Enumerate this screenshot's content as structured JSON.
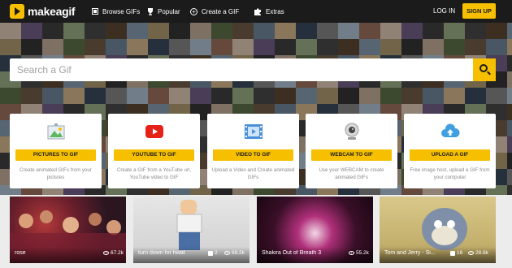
{
  "brand": {
    "name": "makeagif",
    "accent": "#f6c000",
    "nav_bg": "#1b1b1b"
  },
  "nav": {
    "items": [
      {
        "label": "Browse GIFs",
        "icon": "grid-icon"
      },
      {
        "label": "Popular",
        "icon": "trophy-icon"
      },
      {
        "label": "Create a GIF",
        "icon": "plus-circle-icon"
      },
      {
        "label": "Extras",
        "icon": "puzzle-icon"
      }
    ],
    "login": "LOG IN",
    "signup": "SIGN UP"
  },
  "search": {
    "placeholder": "Search a Gif",
    "value": "",
    "icon": "search-icon"
  },
  "cards": [
    {
      "button": "PICTURES TO GIF",
      "desc": "Create animated GIFs from your pictures",
      "icon": "picture-icon"
    },
    {
      "button": "YOUTUBE TO GIF",
      "desc": "Create a GIF from a YouTube url, YouTube video to GIF",
      "icon": "youtube-icon"
    },
    {
      "button": "VIDEO TO GIF",
      "desc": "Upload a Video and Create animated GIFs",
      "icon": "film-icon"
    },
    {
      "button": "WEBCAM TO GIF",
      "desc": "Use your WEBCAM to create animated GIFs",
      "icon": "webcam-icon"
    },
    {
      "button": "UPLOAD A GIF",
      "desc": "Free image host, upload a GIF from your computer",
      "icon": "cloud-upload-icon"
    }
  ],
  "thumbnails": [
    {
      "title": "rose",
      "likes": "",
      "views": "67.2k"
    },
    {
      "title": "turn down for hwat",
      "likes": "2",
      "views": "69.2k"
    },
    {
      "title": "Shakira Out of Breath 3",
      "likes": "",
      "views": "55.2k"
    },
    {
      "title": "Tom and Jerry - Si...",
      "likes": "16",
      "views": "28.8k"
    }
  ]
}
